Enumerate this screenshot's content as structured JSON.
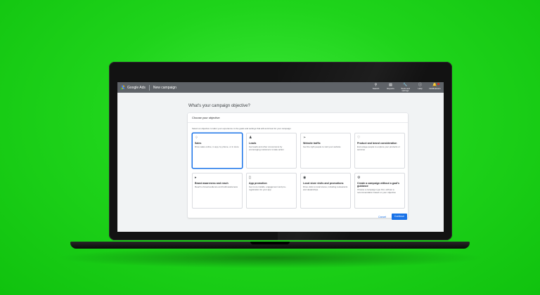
{
  "app": {
    "product_name": "Google Ads",
    "page_title": "New campaign"
  },
  "topbar": {
    "actions": [
      {
        "icon": "search-icon",
        "label": "Search"
      },
      {
        "icon": "reports-icon",
        "label": "Reports"
      },
      {
        "icon": "tools-icon",
        "label": "Tools and settings"
      },
      {
        "icon": "help-icon",
        "label": "Help"
      },
      {
        "icon": "bell-icon",
        "label": "Notifications"
      }
    ]
  },
  "main": {
    "question": "What's your campaign objective?",
    "card_title": "Choose your objective",
    "card_subtitle": "Select an objective to tailor your experience to the goals and settings that will work best for your campaign",
    "objectives": [
      {
        "icon": "tag-icon",
        "title": "Sales",
        "desc": "Drive sales online, in app, by phone, or in store",
        "selected": true
      },
      {
        "icon": "people-icon",
        "title": "Leads",
        "desc": "Get leads and other conversions by encouraging customers to take action",
        "selected": false
      },
      {
        "icon": "cursor-icon",
        "title": "Website traffic",
        "desc": "Get the right people to visit your website",
        "selected": false
      },
      {
        "icon": "heart-icon",
        "title": "Product and brand consideration",
        "desc": "Encourage people to explore your products or services",
        "selected": false
      },
      {
        "icon": "megaphone-icon",
        "title": "Brand awareness and reach",
        "desc": "Reach a broad audience and build awareness",
        "selected": false
      },
      {
        "icon": "phone-icon",
        "title": "App promotion",
        "desc": "Get more installs, engagement and pre-registration for your app",
        "selected": false
      },
      {
        "icon": "location-pin-icon",
        "title": "Local store visits and promotions",
        "desc": "Drive visits to local stores, including restaurants and dealerships.",
        "selected": false
      },
      {
        "icon": "gear-icon",
        "title": "Create a campaign without a goal's guidance",
        "desc": "Choose a campaign type first, without a recommendation based on your objective",
        "selected": false
      }
    ],
    "cancel_label": "Cancel",
    "continue_label": "Continue"
  },
  "colors": {
    "background": "#1fd41b",
    "topbar": "#5f6368",
    "accent": "#1a73e8"
  }
}
